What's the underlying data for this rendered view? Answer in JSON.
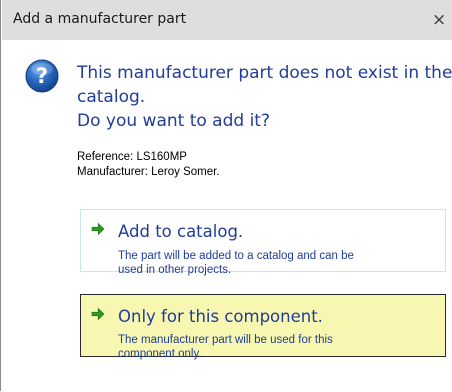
{
  "window": {
    "title": "Add a manufacturer part",
    "close_glyph": "×"
  },
  "icon": {
    "name": "question-icon",
    "color": "#1e63b4"
  },
  "instruction": {
    "line1": "This manufacturer part does not exist in the",
    "line2": "catalog.",
    "line3": "Do you want to add it?"
  },
  "details": {
    "reference": "Reference: LS160MP",
    "manufacturer": "Manufacturer: Leroy Somer."
  },
  "options": {
    "add_to_catalog": {
      "title": "Add to catalog.",
      "desc_line1": "The part will be added to a catalog and can be",
      "desc_line2": "used in other projects."
    },
    "only_component": {
      "title": "Only for this component.",
      "desc_line1": "The manufacturer part will be used  for this",
      "desc_line2": "component only."
    }
  },
  "colors": {
    "instruction_text": "#1f3d98",
    "arrow_green": "#2d9b1e",
    "selected_bg": "#f7f7b1",
    "hover_border": "#c9e6f2"
  }
}
